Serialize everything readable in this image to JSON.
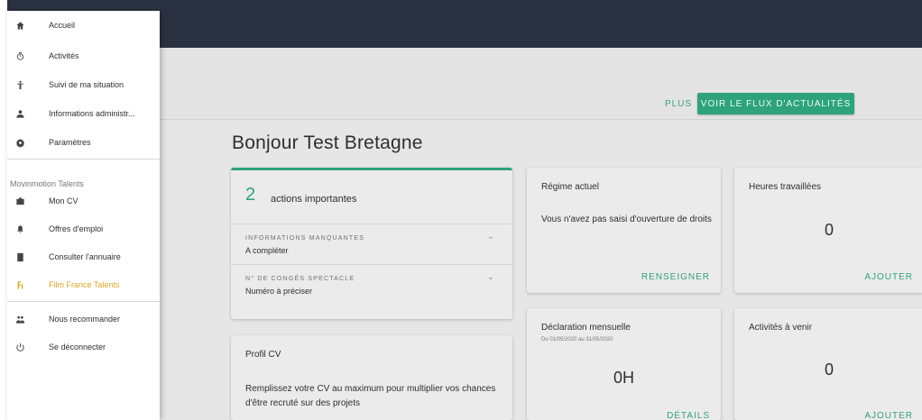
{
  "header": {
    "background": "#2a3140"
  },
  "news": {
    "plus_label": "PLUS",
    "feed_button": "VOIR LE FLUX D'ACTUALITÉS"
  },
  "greeting": "Bonjour Test Bretagne",
  "actions": {
    "count": "2",
    "title": "actions importantes",
    "sections": [
      {
        "title": "INFORMATIONS MANQUANTES",
        "value": "A compléter"
      },
      {
        "title": "N° DE CONGÉS SPECTACLE",
        "value": "Numéro à préciser"
      }
    ]
  },
  "regime": {
    "title": "Régime actuel",
    "text": "Vous n'avez pas saisi d'ouverture de droits",
    "action": "RENSEIGNER"
  },
  "hours": {
    "title": "Heures travaillées",
    "value": "0",
    "action": "AJOUTER"
  },
  "declaration": {
    "title": "Déclaration mensuelle",
    "period": "Du 01/05/2020 au 31/05/2020",
    "total": "0H",
    "action": "DÉTAILS"
  },
  "upcoming": {
    "title": "Activités à venir",
    "value": "0",
    "action": "AJOUTER"
  },
  "profile": {
    "title": "Profil CV",
    "text": "Remplissez votre CV au maximum pour multiplier vos chances d'être recruté sur des projets"
  },
  "drawer": {
    "items_top": [
      {
        "label": "Accueil",
        "icon": "home-icon"
      },
      {
        "label": "Activités",
        "icon": "timer-icon"
      },
      {
        "label": "Suivi de ma situation",
        "icon": "person-icon"
      },
      {
        "label": "Informations administr...",
        "icon": "account-icon"
      },
      {
        "label": "Paramètres",
        "icon": "settings-icon"
      }
    ],
    "section_title": "Movinmotion Talents",
    "items_talents": [
      {
        "label": "Mon CV",
        "icon": "briefcase-icon"
      },
      {
        "label": "Offres d'emploi",
        "icon": "bell-icon"
      },
      {
        "label": "Consulter l'annuaire",
        "icon": "directory-icon"
      },
      {
        "label": "Film France Talents",
        "icon": "film-france-icon"
      }
    ],
    "items_bottom": [
      {
        "label": "Nous recommander",
        "icon": "group-icon"
      },
      {
        "label": "Se déconnecter",
        "icon": "power-icon"
      }
    ],
    "active_color": "#d8a72c"
  },
  "accent_color": "#2ea27a"
}
